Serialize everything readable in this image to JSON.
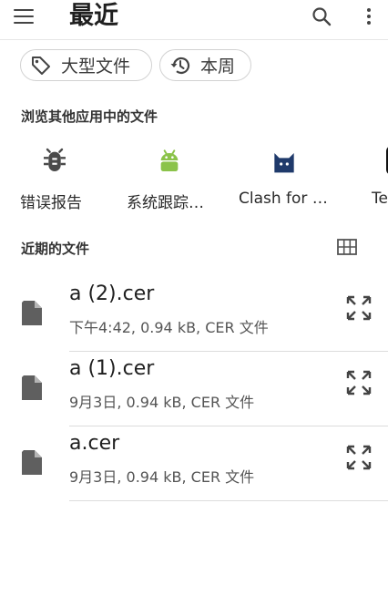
{
  "header": {
    "title": "最近",
    "menu_icon": "menu-icon",
    "search_icon": "search-icon",
    "more_icon": "more-vert-icon"
  },
  "chips": [
    {
      "label": "大型文件",
      "icon": "tag-icon"
    },
    {
      "label": "本周",
      "icon": "history-icon"
    }
  ],
  "browse_section": {
    "title": "浏览其他应用中的文件",
    "apps": [
      {
        "label": "错误报告",
        "icon": "bug-icon"
      },
      {
        "label": "系统跟踪…",
        "icon": "android-icon"
      },
      {
        "label": "Clash for …",
        "icon": "cat-icon"
      },
      {
        "label": "Te",
        "icon": "app-icon"
      }
    ]
  },
  "recent_section": {
    "title": "近期的文件",
    "view_toggle_icon": "grid-view-icon",
    "files": [
      {
        "name": "a (2).cer",
        "meta": "下午4:42, 0.94 kB, CER 文件"
      },
      {
        "name": "a (1).cer",
        "meta": "9月3日, 0.94 kB, CER 文件"
      },
      {
        "name": "a.cer",
        "meta": "9月3日, 0.94 kB, CER 文件"
      }
    ]
  },
  "colors": {
    "bug": "#4a4a4a",
    "android": "#8bc34a",
    "clash": "#1f3a6b",
    "icon_gray": "#5f5f5f"
  }
}
